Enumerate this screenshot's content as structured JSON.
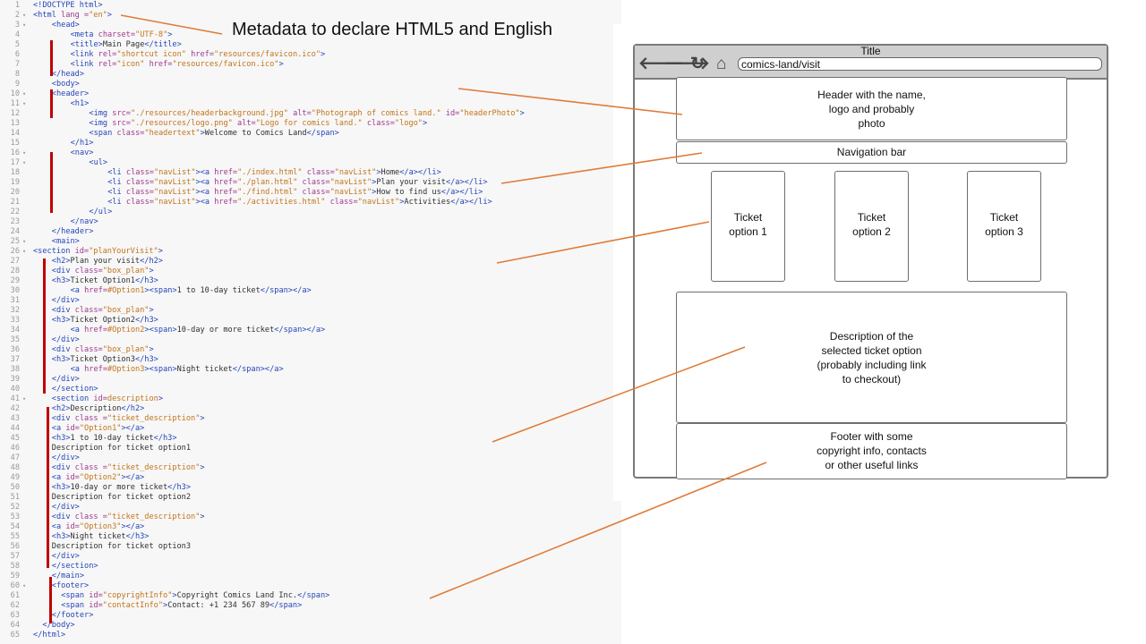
{
  "callout": "Metadata to declare HTML5 and English",
  "code_lines": [
    {
      "n": "1",
      "f": "",
      "indent": 0,
      "parts": [
        [
          "tag",
          "<!DOCTYPE html>"
        ]
      ]
    },
    {
      "n": "2",
      "f": "▾",
      "indent": 0,
      "parts": [
        [
          "tag",
          "<html "
        ],
        [
          "attr",
          "lang ="
        ],
        [
          "str",
          "\"en\""
        ],
        [
          "tag",
          ">"
        ]
      ]
    },
    {
      "n": "3",
      "f": "▾",
      "indent": 4,
      "parts": [
        [
          "tag",
          "<head>"
        ]
      ]
    },
    {
      "n": "4",
      "f": "",
      "indent": 8,
      "parts": [
        [
          "tag",
          "<meta "
        ],
        [
          "attr",
          "charset="
        ],
        [
          "str",
          "\"UTF-8\""
        ],
        [
          "tag",
          ">"
        ]
      ]
    },
    {
      "n": "5",
      "f": "",
      "indent": 8,
      "parts": [
        [
          "tag",
          "<title>"
        ],
        [
          "text",
          "Main Page"
        ],
        [
          "tag",
          "</title>"
        ]
      ]
    },
    {
      "n": "6",
      "f": "",
      "indent": 8,
      "parts": [
        [
          "tag",
          "<link "
        ],
        [
          "attr",
          "rel="
        ],
        [
          "str",
          "\"shortcut icon\""
        ],
        [
          "attr",
          " href="
        ],
        [
          "str",
          "\"resources/favicon.ico\""
        ],
        [
          "tag",
          ">"
        ]
      ]
    },
    {
      "n": "7",
      "f": "",
      "indent": 8,
      "parts": [
        [
          "tag",
          "<link "
        ],
        [
          "attr",
          "rel="
        ],
        [
          "str",
          "\"icon\""
        ],
        [
          "attr",
          " href="
        ],
        [
          "str",
          "\"resources/favicon.ico\""
        ],
        [
          "tag",
          ">"
        ]
      ]
    },
    {
      "n": "8",
      "f": "",
      "indent": 4,
      "parts": [
        [
          "tag",
          "</head>"
        ]
      ]
    },
    {
      "n": "9",
      "f": "",
      "indent": 4,
      "parts": [
        [
          "tag",
          "<body>"
        ]
      ]
    },
    {
      "n": "10",
      "f": "▾",
      "indent": 4,
      "parts": [
        [
          "tag",
          "<header>"
        ]
      ]
    },
    {
      "n": "11",
      "f": "▾",
      "indent": 8,
      "parts": [
        [
          "tag",
          "<h1>"
        ]
      ]
    },
    {
      "n": "12",
      "f": "",
      "indent": 12,
      "parts": [
        [
          "tag",
          "<img "
        ],
        [
          "attr",
          "src="
        ],
        [
          "str",
          "\"./resources/headerbackground.jpg\""
        ],
        [
          "attr",
          " alt="
        ],
        [
          "str",
          "\"Photograph of comics land.\""
        ],
        [
          "attr",
          " id="
        ],
        [
          "str",
          "\"headerPhoto\""
        ],
        [
          "tag",
          ">"
        ]
      ]
    },
    {
      "n": "13",
      "f": "",
      "indent": 12,
      "parts": [
        [
          "tag",
          "<img "
        ],
        [
          "attr",
          "src="
        ],
        [
          "str",
          "\"./resources/logo.png\""
        ],
        [
          "attr",
          " alt="
        ],
        [
          "str",
          "\"Logo for comics land.\""
        ],
        [
          "attr",
          " class="
        ],
        [
          "str",
          "\"logo\""
        ],
        [
          "tag",
          ">"
        ]
      ]
    },
    {
      "n": "14",
      "f": "",
      "indent": 12,
      "parts": [
        [
          "tag",
          "<span "
        ],
        [
          "attr",
          "class="
        ],
        [
          "str",
          "\"headertext\""
        ],
        [
          "tag",
          ">"
        ],
        [
          "text",
          "Welcome to Comics Land"
        ],
        [
          "tag",
          "</span>"
        ]
      ]
    },
    {
      "n": "15",
      "f": "",
      "indent": 8,
      "parts": [
        [
          "tag",
          "</h1>"
        ]
      ]
    },
    {
      "n": "16",
      "f": "▾",
      "indent": 8,
      "parts": [
        [
          "tag",
          "<nav>"
        ]
      ]
    },
    {
      "n": "17",
      "f": "▾",
      "indent": 12,
      "parts": [
        [
          "tag",
          "<ul>"
        ]
      ]
    },
    {
      "n": "18",
      "f": "",
      "indent": 16,
      "parts": [
        [
          "tag",
          "<li "
        ],
        [
          "attr",
          "class="
        ],
        [
          "str",
          "\"navList\""
        ],
        [
          "tag",
          "><a "
        ],
        [
          "attr",
          "href="
        ],
        [
          "str",
          "\"./index.html\""
        ],
        [
          "attr",
          " class="
        ],
        [
          "str",
          "\"navList\""
        ],
        [
          "tag",
          ">"
        ],
        [
          "text",
          "Home"
        ],
        [
          "tag",
          "</a></li>"
        ]
      ]
    },
    {
      "n": "19",
      "f": "",
      "indent": 16,
      "parts": [
        [
          "tag",
          "<li "
        ],
        [
          "attr",
          "class="
        ],
        [
          "str",
          "\"navList\""
        ],
        [
          "tag",
          "><a "
        ],
        [
          "attr",
          "href="
        ],
        [
          "str",
          "\"./plan.html\""
        ],
        [
          "attr",
          " class="
        ],
        [
          "str",
          "\"navList\""
        ],
        [
          "tag",
          ">"
        ],
        [
          "text",
          "Plan your visit"
        ],
        [
          "tag",
          "</a></li>"
        ]
      ]
    },
    {
      "n": "20",
      "f": "",
      "indent": 16,
      "parts": [
        [
          "tag",
          "<li "
        ],
        [
          "attr",
          "class="
        ],
        [
          "str",
          "\"navList\""
        ],
        [
          "tag",
          "><a "
        ],
        [
          "attr",
          "href="
        ],
        [
          "str",
          "\"./find.html\""
        ],
        [
          "attr",
          " class="
        ],
        [
          "str",
          "\"navList\""
        ],
        [
          "tag",
          ">"
        ],
        [
          "text",
          "How to find us"
        ],
        [
          "tag",
          "</a></li>"
        ]
      ]
    },
    {
      "n": "21",
      "f": "",
      "indent": 16,
      "parts": [
        [
          "tag",
          "<li "
        ],
        [
          "attr",
          "class="
        ],
        [
          "str",
          "\"navList\""
        ],
        [
          "tag",
          "><a "
        ],
        [
          "attr",
          "href="
        ],
        [
          "str",
          "\"./activities.html\""
        ],
        [
          "attr",
          " class="
        ],
        [
          "str",
          "\"navList\""
        ],
        [
          "tag",
          ">"
        ],
        [
          "text",
          "Activities"
        ],
        [
          "tag",
          "</a></li>"
        ]
      ]
    },
    {
      "n": "22",
      "f": "",
      "indent": 12,
      "parts": [
        [
          "tag",
          "</ul>"
        ]
      ]
    },
    {
      "n": "23",
      "f": "",
      "indent": 8,
      "parts": [
        [
          "tag",
          "</nav>"
        ]
      ]
    },
    {
      "n": "24",
      "f": "",
      "indent": 4,
      "parts": [
        [
          "tag",
          "</header>"
        ]
      ]
    },
    {
      "n": "25",
      "f": "▾",
      "indent": 4,
      "parts": [
        [
          "tag",
          "<main>"
        ]
      ]
    },
    {
      "n": "26",
      "f": "▾",
      "indent": 0,
      "parts": [
        [
          "tag",
          "<section "
        ],
        [
          "attr",
          "id="
        ],
        [
          "str",
          "\"planYourVisit\""
        ],
        [
          "tag",
          ">"
        ]
      ]
    },
    {
      "n": "27",
      "f": "",
      "indent": 4,
      "parts": [
        [
          "tag",
          "<h2>"
        ],
        [
          "text",
          "Plan your visit"
        ],
        [
          "tag",
          "</h2>"
        ]
      ]
    },
    {
      "n": "28",
      "f": "",
      "indent": 4,
      "parts": [
        [
          "tag",
          "<div "
        ],
        [
          "attr",
          "class="
        ],
        [
          "str",
          "\"box_plan\""
        ],
        [
          "tag",
          ">"
        ]
      ]
    },
    {
      "n": "29",
      "f": "",
      "indent": 4,
      "parts": [
        [
          "tag",
          "<h3>"
        ],
        [
          "text",
          "Ticket Option1"
        ],
        [
          "tag",
          "</h3>"
        ]
      ]
    },
    {
      "n": "30",
      "f": "",
      "indent": 8,
      "parts": [
        [
          "tag",
          "<a "
        ],
        [
          "attr",
          "href="
        ],
        [
          "str",
          "#Option1"
        ],
        [
          "tag",
          "><span>"
        ],
        [
          "text",
          "1 to 10-day ticket"
        ],
        [
          "tag",
          "</span></a>"
        ]
      ]
    },
    {
      "n": "31",
      "f": "",
      "indent": 4,
      "parts": [
        [
          "tag",
          "</div>"
        ]
      ]
    },
    {
      "n": "32",
      "f": "",
      "indent": 4,
      "parts": [
        [
          "tag",
          "<div "
        ],
        [
          "attr",
          "class="
        ],
        [
          "str",
          "\"box_plan\""
        ],
        [
          "tag",
          ">"
        ]
      ]
    },
    {
      "n": "33",
      "f": "",
      "indent": 4,
      "parts": [
        [
          "tag",
          "<h3>"
        ],
        [
          "text",
          "Ticket Option2"
        ],
        [
          "tag",
          "</h3>"
        ]
      ]
    },
    {
      "n": "34",
      "f": "",
      "indent": 8,
      "parts": [
        [
          "tag",
          "<a "
        ],
        [
          "attr",
          "href="
        ],
        [
          "str",
          "#Option2"
        ],
        [
          "tag",
          "><span>"
        ],
        [
          "text",
          "10-day or more ticket"
        ],
        [
          "tag",
          "</span></a>"
        ]
      ]
    },
    {
      "n": "35",
      "f": "",
      "indent": 4,
      "parts": [
        [
          "tag",
          "</div>"
        ]
      ]
    },
    {
      "n": "36",
      "f": "",
      "indent": 4,
      "parts": [
        [
          "tag",
          "<div "
        ],
        [
          "attr",
          "class="
        ],
        [
          "str",
          "\"box_plan\""
        ],
        [
          "tag",
          ">"
        ]
      ]
    },
    {
      "n": "37",
      "f": "",
      "indent": 4,
      "parts": [
        [
          "tag",
          "<h3>"
        ],
        [
          "text",
          "Ticket Option3"
        ],
        [
          "tag",
          "</h3>"
        ]
      ]
    },
    {
      "n": "38",
      "f": "",
      "indent": 8,
      "parts": [
        [
          "tag",
          "<a "
        ],
        [
          "attr",
          "href="
        ],
        [
          "str",
          "#Option3"
        ],
        [
          "tag",
          "><span>"
        ],
        [
          "text",
          "Night ticket"
        ],
        [
          "tag",
          "</span></a>"
        ]
      ]
    },
    {
      "n": "39",
      "f": "",
      "indent": 4,
      "parts": [
        [
          "tag",
          "</div>"
        ]
      ]
    },
    {
      "n": "40",
      "f": "",
      "indent": 4,
      "parts": [
        [
          "tag",
          "</section>"
        ]
      ]
    },
    {
      "n": "41",
      "f": "▾",
      "indent": 4,
      "parts": [
        [
          "tag",
          "<section "
        ],
        [
          "attr",
          "id="
        ],
        [
          "str",
          "description"
        ],
        [
          "tag",
          ">"
        ]
      ]
    },
    {
      "n": "42",
      "f": "",
      "indent": 4,
      "parts": [
        [
          "tag",
          "<h2>"
        ],
        [
          "text",
          "Description"
        ],
        [
          "tag",
          "</h2>"
        ]
      ]
    },
    {
      "n": "43",
      "f": "",
      "indent": 4,
      "parts": [
        [
          "tag",
          "<div "
        ],
        [
          "attr",
          "class ="
        ],
        [
          "str",
          "\"ticket_description\""
        ],
        [
          "tag",
          ">"
        ]
      ]
    },
    {
      "n": "44",
      "f": "",
      "indent": 4,
      "parts": [
        [
          "tag",
          "<a "
        ],
        [
          "attr",
          "id="
        ],
        [
          "str",
          "\"Option1\""
        ],
        [
          "tag",
          "></a>"
        ]
      ]
    },
    {
      "n": "45",
      "f": "",
      "indent": 4,
      "parts": [
        [
          "tag",
          "<h3>"
        ],
        [
          "text",
          "1 to 10-day ticket"
        ],
        [
          "tag",
          "</h3>"
        ]
      ]
    },
    {
      "n": "46",
      "f": "",
      "indent": 4,
      "parts": [
        [
          "text",
          "Description for ticket option1"
        ]
      ]
    },
    {
      "n": "47",
      "f": "",
      "indent": 4,
      "parts": [
        [
          "tag",
          "</div>"
        ]
      ]
    },
    {
      "n": "48",
      "f": "",
      "indent": 4,
      "parts": [
        [
          "tag",
          "<div "
        ],
        [
          "attr",
          "class ="
        ],
        [
          "str",
          "\"ticket_description\""
        ],
        [
          "tag",
          ">"
        ]
      ]
    },
    {
      "n": "49",
      "f": "",
      "indent": 4,
      "parts": [
        [
          "tag",
          "<a "
        ],
        [
          "attr",
          "id="
        ],
        [
          "str",
          "\"Option2\""
        ],
        [
          "tag",
          "></a>"
        ]
      ]
    },
    {
      "n": "50",
      "f": "",
      "indent": 4,
      "parts": [
        [
          "tag",
          "<h3>"
        ],
        [
          "text",
          "10-day or more ticket"
        ],
        [
          "tag",
          "</h3>"
        ]
      ]
    },
    {
      "n": "51",
      "f": "",
      "indent": 4,
      "parts": [
        [
          "text",
          "Description for ticket option2"
        ]
      ]
    },
    {
      "n": "52",
      "f": "",
      "indent": 4,
      "parts": [
        [
          "tag",
          "</div>"
        ]
      ]
    },
    {
      "n": "53",
      "f": "",
      "indent": 4,
      "parts": [
        [
          "tag",
          "<div "
        ],
        [
          "attr",
          "class ="
        ],
        [
          "str",
          "\"ticket_description\""
        ],
        [
          "tag",
          ">"
        ]
      ]
    },
    {
      "n": "54",
      "f": "",
      "indent": 4,
      "parts": [
        [
          "tag",
          "<a "
        ],
        [
          "attr",
          "id="
        ],
        [
          "str",
          "\"Option3\""
        ],
        [
          "tag",
          "></a>"
        ]
      ]
    },
    {
      "n": "55",
      "f": "",
      "indent": 4,
      "parts": [
        [
          "tag",
          "<h3>"
        ],
        [
          "text",
          "Night ticket"
        ],
        [
          "tag",
          "</h3>"
        ]
      ]
    },
    {
      "n": "56",
      "f": "",
      "indent": 4,
      "parts": [
        [
          "text",
          "Description for ticket option3"
        ]
      ]
    },
    {
      "n": "57",
      "f": "",
      "indent": 4,
      "parts": [
        [
          "tag",
          "</div>"
        ]
      ]
    },
    {
      "n": "58",
      "f": "",
      "indent": 4,
      "parts": [
        [
          "tag",
          "</section>"
        ]
      ]
    },
    {
      "n": "59",
      "f": "",
      "indent": 4,
      "parts": [
        [
          "tag",
          "</main>"
        ]
      ]
    },
    {
      "n": "60",
      "f": "▾",
      "indent": 4,
      "parts": [
        [
          "tag",
          "<footer>"
        ]
      ]
    },
    {
      "n": "61",
      "f": "",
      "indent": 6,
      "parts": [
        [
          "tag",
          "<span "
        ],
        [
          "attr",
          "id="
        ],
        [
          "str",
          "\"copyrightInfo\""
        ],
        [
          "tag",
          ">"
        ],
        [
          "text",
          "Copyright Comics Land Inc."
        ],
        [
          "tag",
          "</span>"
        ]
      ]
    },
    {
      "n": "62",
      "f": "",
      "indent": 6,
      "parts": [
        [
          "tag",
          "<span "
        ],
        [
          "attr",
          "id="
        ],
        [
          "str",
          "\"contactInfo\""
        ],
        [
          "tag",
          ">"
        ],
        [
          "text",
          "Contact: +1 234 567 89"
        ],
        [
          "tag",
          "</span>"
        ]
      ]
    },
    {
      "n": "63",
      "f": "",
      "indent": 4,
      "parts": [
        [
          "tag",
          "</footer>"
        ]
      ]
    },
    {
      "n": "64",
      "f": "",
      "indent": 2,
      "parts": [
        [
          "tag",
          "</body>"
        ]
      ]
    },
    {
      "n": "65",
      "f": "",
      "indent": 0,
      "parts": [
        [
          "tag",
          "</html>"
        ]
      ]
    }
  ],
  "wireframe": {
    "title": "Title",
    "url": "comics-land/visit",
    "icons": [
      "back-arrow-icon",
      "forward-arrow-icon",
      "reload-icon",
      "home-icon"
    ],
    "header_lines": [
      "Header with the name,",
      "logo and probably",
      "photo"
    ],
    "nav": "Navigation bar",
    "tickets": [
      [
        "Ticket",
        "option 1"
      ],
      [
        "Ticket",
        "option 2"
      ],
      [
        "Ticket",
        "option 3"
      ]
    ],
    "description_lines": [
      "Description of the",
      "selected ticket option",
      "(probably including link",
      "to checkout)"
    ],
    "footer_lines": [
      "Footer with some",
      "copyright info, contacts",
      "or other useful links"
    ]
  },
  "colors": {
    "tag": "#2546b8",
    "attribute": "#a0398c",
    "string": "#c2741b",
    "text": "#303030",
    "marker": "#c00000",
    "arrow": "#e07b39",
    "wire_border": "#6e6e6e"
  }
}
